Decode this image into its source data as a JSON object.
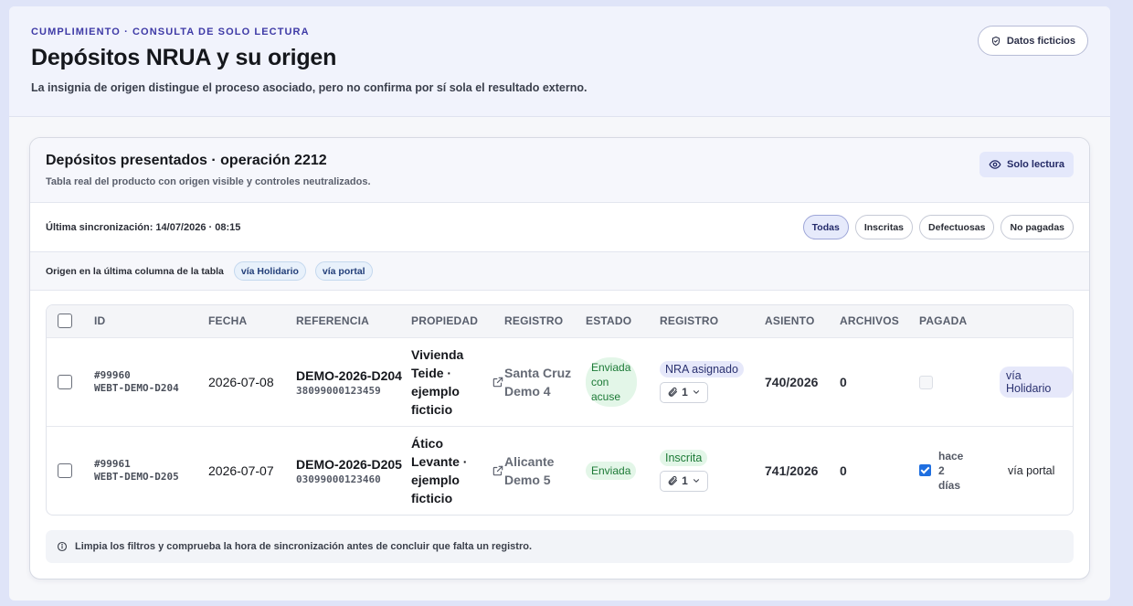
{
  "header": {
    "eyebrow": "CUMPLIMIENTO · CONSULTA DE SOLO LECTURA",
    "title": "Depósitos NRUA y su origen",
    "subtitle": "La insignia de origen distingue el proceso asociado, pero no confirma por sí sola el resultado externo.",
    "demo_badge": "Datos ficticios"
  },
  "card": {
    "title": "Depósitos presentados · operación 2212",
    "subtitle": "Tabla real del producto con origen visible y controles neutralizados.",
    "readonly_badge": "Solo lectura",
    "sync_text": "Última sincronización: 14/07/2026 · 08:15",
    "filters": [
      "Todas",
      "Inscritas",
      "Defectuosas",
      "No pagadas"
    ],
    "active_filter": "Todas",
    "origin_label": "Origen en la última columna de la tabla",
    "origin_pills": [
      "vía Holidario",
      "vía portal"
    ],
    "hint": "Limpia los filtros y comprueba la hora de sincronización antes de concluir que falta un registro."
  },
  "table": {
    "headers": [
      "ID",
      "FECHA",
      "REFERENCIA",
      "PROPIEDAD",
      "REGISTRO",
      "ESTADO",
      "REGISTRO",
      "ASIENTO",
      "ARCHIVOS",
      "PAGADA"
    ],
    "rows": [
      {
        "id": "#99960",
        "id_code": "WEBT-DEMO-D204",
        "fecha": "2026-07-08",
        "ref_main": "DEMO-2026-D204",
        "ref_code": "38099000123459",
        "propiedad": "Vivienda Teide · ejemplo ficticio",
        "registro": "Santa Cruz Demo 4",
        "estado": "Enviada con acuse",
        "registro_badge": "NRA asignado",
        "adjuntos": "1",
        "asiento": "740/2026",
        "archivos": "0",
        "pagada": false,
        "pagada_nota": "",
        "origen": "vía Holidario"
      },
      {
        "id": "#99961",
        "id_code": "WEBT-DEMO-D205",
        "fecha": "2026-07-07",
        "ref_main": "DEMO-2026-D205",
        "ref_code": "03099000123460",
        "propiedad": "Ático Levante · ejemplo ficticio",
        "registro": "Alicante Demo 5",
        "estado": "Enviada",
        "registro_badge": "Inscrita",
        "adjuntos": "1",
        "asiento": "741/2026",
        "archivos": "0",
        "pagada": true,
        "pagada_nota": "hace 2 días",
        "origen": "vía portal"
      }
    ]
  },
  "colors": {
    "accent": "#3e3aa6",
    "success_bg": "#e3f6e8",
    "success_text": "#1c7a36",
    "checkbox": "#1f6fe0"
  }
}
